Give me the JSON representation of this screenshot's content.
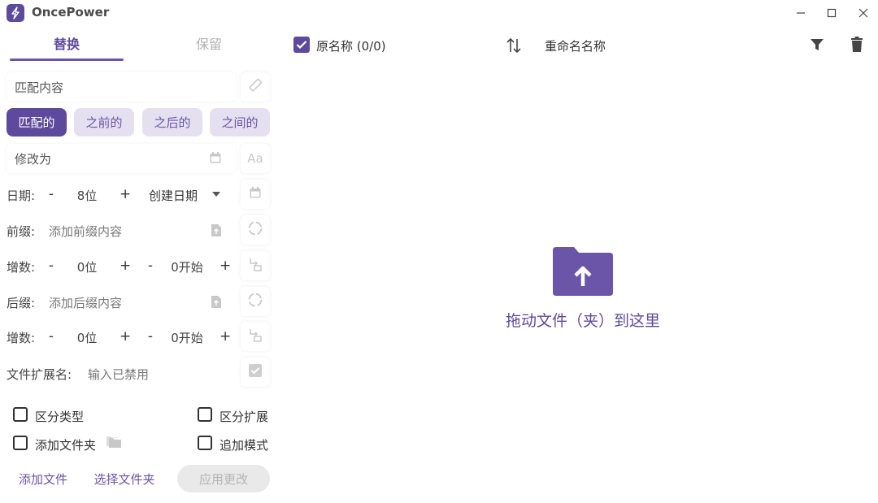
{
  "app": {
    "title": "OncePower"
  },
  "window": {
    "minimize_icon": "minimize-icon",
    "maximize_icon": "maximize-icon",
    "close_icon": "close-icon"
  },
  "tabs": [
    {
      "label": "替换",
      "active": true
    },
    {
      "label": "保留",
      "active": false
    }
  ],
  "replace": {
    "match_placeholder": "匹配内容",
    "modes": [
      {
        "label": "匹配的",
        "active": true
      },
      {
        "label": "之前的",
        "active": false
      },
      {
        "label": "之后的",
        "active": false
      },
      {
        "label": "之间的",
        "active": false
      }
    ],
    "modify_placeholder": "修改为"
  },
  "date_row": {
    "label": "日期:",
    "minus": "-",
    "value": "8位",
    "plus": "+",
    "type": "创建日期"
  },
  "prefix_row": {
    "label": "前缀:",
    "placeholder": "添加前缀内容"
  },
  "increment1": {
    "label": "增数:",
    "minus": "-",
    "digits": "0位",
    "plus": "+",
    "minus2": "-",
    "start": "0开始",
    "plus2": "+"
  },
  "suffix_row": {
    "label": "后缀:",
    "placeholder": "添加后缀内容"
  },
  "increment2": {
    "label": "增数:",
    "minus": "-",
    "digits": "0位",
    "plus": "+",
    "minus2": "-",
    "start": "0开始",
    "plus2": "+"
  },
  "ext_row": {
    "label": "文件扩展名:",
    "placeholder": "输入已禁用"
  },
  "options": {
    "distinguish_type": "区分类型",
    "distinguish_ext": "区分扩展",
    "add_folder": "添加文件夹",
    "append_mode": "追加模式"
  },
  "buttons": {
    "add_file": "添加文件",
    "select_folder": "选择文件夹",
    "apply": "应用更改"
  },
  "file_list": {
    "original_name": "原名称 (0/0)",
    "new_name": "重命名名称",
    "drop_hint": "拖动文件（夹）到这里"
  },
  "colors": {
    "accent": "#5e4a9c",
    "accent_light": "#e4e0ef"
  }
}
